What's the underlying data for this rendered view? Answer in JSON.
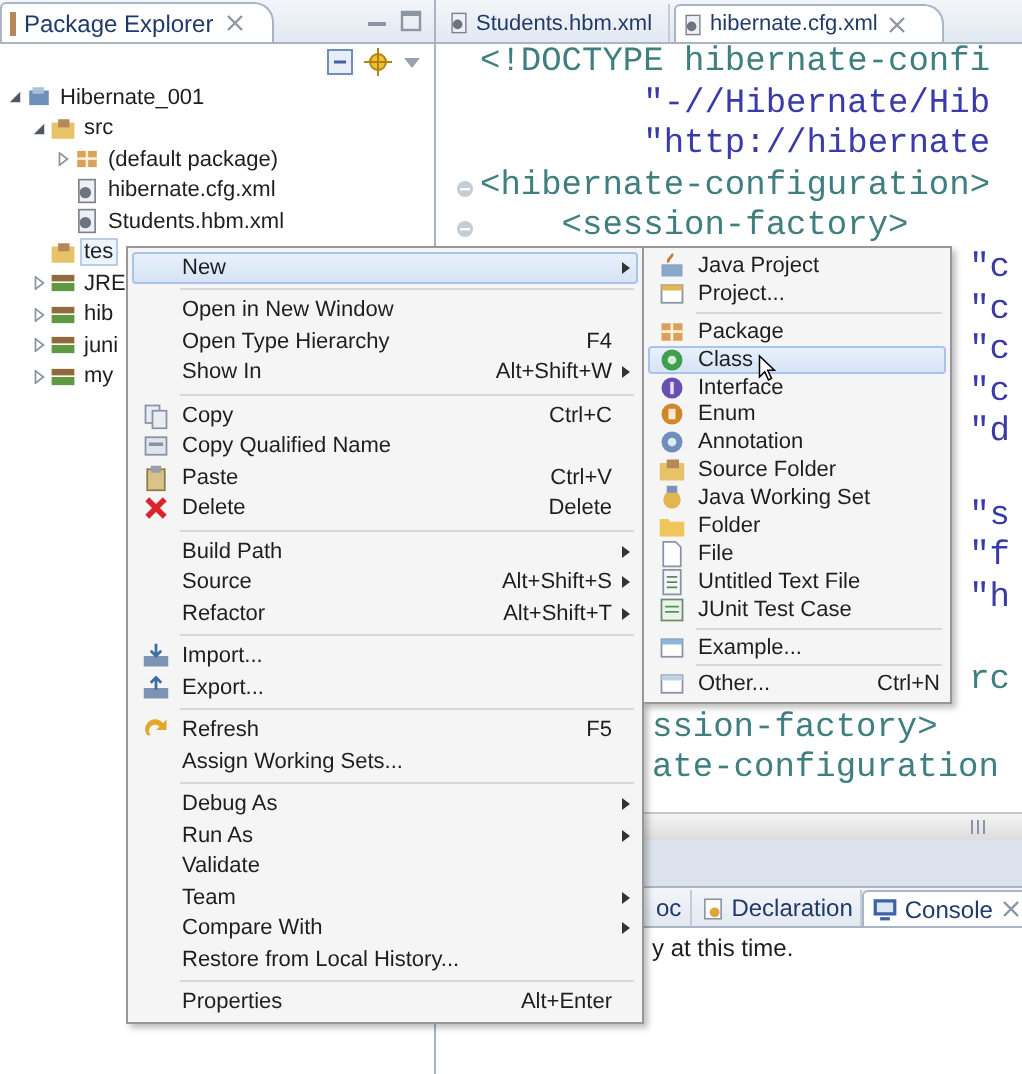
{
  "package_explorer": {
    "title": "Package Explorer",
    "tree": [
      {
        "label": "Hibernate_001",
        "kind": "project",
        "expanded": true,
        "selected": false,
        "children": [
          {
            "label": "src",
            "kind": "source-folder",
            "expanded": true,
            "selected": false,
            "children": [
              {
                "label": "(default package)",
                "kind": "package",
                "expanded": false,
                "selected": false
              },
              {
                "label": "hibernate.cfg.xml",
                "kind": "xml",
                "selected": false
              },
              {
                "label": "Students.hbm.xml",
                "kind": "xml",
                "selected": false
              }
            ]
          },
          {
            "label": "tes",
            "kind": "source-folder",
            "selected": true
          },
          {
            "label": "JRE",
            "kind": "library",
            "expanded": false,
            "selected": false
          },
          {
            "label": "hib",
            "kind": "library",
            "expanded": false,
            "selected": false
          },
          {
            "label": "juni",
            "kind": "library",
            "expanded": false,
            "selected": false
          },
          {
            "label": "my",
            "kind": "library",
            "expanded": false,
            "selected": false
          }
        ]
      }
    ]
  },
  "editor_tabs": [
    {
      "label": "Students.hbm.xml",
      "selected": false
    },
    {
      "label": "hibernate.cfg.xml",
      "selected": true
    }
  ],
  "editor_lines": [
    {
      "text": "<!DOCTYPE hibernate-confi",
      "kind": "tag"
    },
    {
      "text": "        \"-//Hibernate/Hib",
      "kind": "string"
    },
    {
      "text": "        \"http://hibernate",
      "kind": "string"
    },
    {
      "text": "<hibernate-configuration>",
      "kind": "tag",
      "fold": true
    },
    {
      "text": "    <session-factory>",
      "kind": "tag",
      "fold": true
    },
    {
      "text": "\"c",
      "kind": "string-end"
    },
    {
      "text": "\"c",
      "kind": "string-end"
    },
    {
      "text": "\"c",
      "kind": "string-end"
    },
    {
      "text": "\"c",
      "kind": "string-end"
    },
    {
      "text": "\"d",
      "kind": "string-end"
    },
    {
      "text": "\"s",
      "kind": "string-end",
      "gap_before": true
    },
    {
      "text": "\"f",
      "kind": "string-end"
    },
    {
      "text": "\"h",
      "kind": "string-end"
    },
    {
      "text": "rc",
      "kind": "tag-end",
      "gap_before": true
    },
    {
      "text": "ssion-factory>",
      "kind": "tag-tail"
    },
    {
      "text": "ate-configuration",
      "kind": "tag-tail"
    }
  ],
  "bottom_tabs": [
    {
      "label": "oc",
      "kind": "plain",
      "selected": false
    },
    {
      "label": "Declaration",
      "kind": "declaration",
      "selected": false
    },
    {
      "label": "Console",
      "kind": "console",
      "selected": true
    }
  ],
  "console_text": "y at this time.",
  "context_menu": {
    "groups": [
      {
        "items": [
          {
            "label": "New",
            "submenu": true,
            "selected": true
          }
        ]
      },
      {
        "items": [
          {
            "label": "Open in New Window",
            "selected": false
          },
          {
            "label": "Open Type Hierarchy",
            "shortcut": "F4",
            "selected": false
          },
          {
            "label": "Show In",
            "shortcut": "Alt+Shift+W",
            "submenu": true,
            "selected": false
          }
        ]
      },
      {
        "items": [
          {
            "label": "Copy",
            "kind": "copy",
            "shortcut": "Ctrl+C",
            "selected": false
          },
          {
            "label": "Copy Qualified Name",
            "kind": "copy-name",
            "selected": false
          },
          {
            "label": "Paste",
            "kind": "paste",
            "shortcut": "Ctrl+V",
            "selected": false
          },
          {
            "label": "Delete",
            "kind": "delete",
            "shortcut": "Delete",
            "selected": false
          }
        ]
      },
      {
        "items": [
          {
            "label": "Build Path",
            "submenu": true,
            "selected": false
          },
          {
            "label": "Source",
            "shortcut": "Alt+Shift+S",
            "submenu": true,
            "selected": false
          },
          {
            "label": "Refactor",
            "shortcut": "Alt+Shift+T",
            "submenu": true,
            "selected": false
          }
        ]
      },
      {
        "items": [
          {
            "label": "Import...",
            "kind": "import",
            "selected": false
          },
          {
            "label": "Export...",
            "kind": "export",
            "selected": false
          }
        ]
      },
      {
        "items": [
          {
            "label": "Refresh",
            "kind": "refresh",
            "shortcut": "F5",
            "selected": false
          },
          {
            "label": "Assign Working Sets...",
            "selected": false
          }
        ]
      },
      {
        "items": [
          {
            "label": "Debug As",
            "submenu": true,
            "selected": false
          },
          {
            "label": "Run As",
            "submenu": true,
            "selected": false
          },
          {
            "label": "Validate",
            "selected": false
          },
          {
            "label": "Team",
            "submenu": true,
            "selected": false
          },
          {
            "label": "Compare With",
            "submenu": true,
            "selected": false
          },
          {
            "label": "Restore from Local History...",
            "selected": false
          }
        ]
      },
      {
        "items": [
          {
            "label": "Properties",
            "shortcut": "Alt+Enter",
            "selected": false
          }
        ]
      }
    ]
  },
  "new_submenu": {
    "groups": [
      {
        "items": [
          {
            "label": "Java Project",
            "kind": "java-project",
            "selected": false
          },
          {
            "label": "Project...",
            "kind": "project",
            "selected": false
          }
        ]
      },
      {
        "items": [
          {
            "label": "Package",
            "kind": "package",
            "selected": false
          },
          {
            "label": "Class",
            "kind": "class",
            "selected": true
          },
          {
            "label": "Interface",
            "kind": "interface",
            "selected": false
          },
          {
            "label": "Enum",
            "kind": "enum",
            "selected": false
          },
          {
            "label": "Annotation",
            "kind": "annotation",
            "selected": false
          },
          {
            "label": "Source Folder",
            "kind": "source-folder",
            "selected": false
          },
          {
            "label": "Java Working Set",
            "kind": "working-set",
            "selected": false
          },
          {
            "label": "Folder",
            "kind": "folder",
            "selected": false
          },
          {
            "label": "File",
            "kind": "file",
            "selected": false
          },
          {
            "label": "Untitled Text File",
            "kind": "text-file",
            "selected": false
          },
          {
            "label": "JUnit Test Case",
            "kind": "junit",
            "selected": false
          }
        ]
      },
      {
        "items": [
          {
            "label": "Example...",
            "kind": "example",
            "selected": false
          }
        ]
      },
      {
        "items": [
          {
            "label": "Other...",
            "kind": "other",
            "shortcut": "Ctrl+N",
            "selected": false
          }
        ]
      }
    ]
  }
}
